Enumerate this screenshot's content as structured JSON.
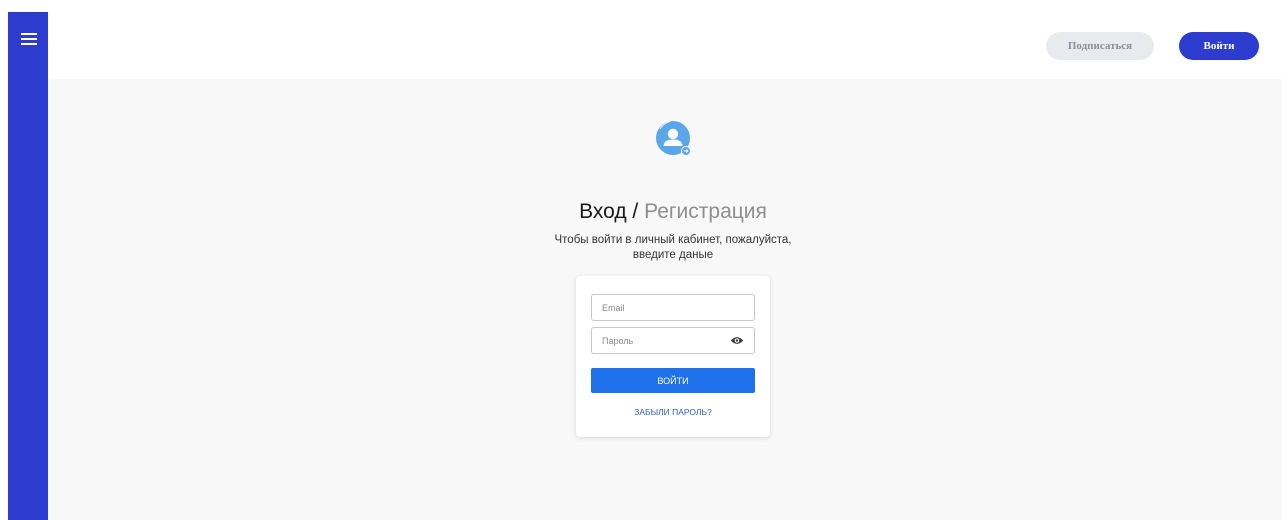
{
  "header": {
    "subscribe_label": "Подписаться",
    "login_label": "Войти"
  },
  "login": {
    "title_primary": "Вход /",
    "title_secondary": "Регистрация",
    "subtitle_line1": "Чтобы войти в личный кабинет, пожалуйста,",
    "subtitle_line2": "введите даные",
    "email_placeholder": "Email",
    "password_placeholder": "Пароль",
    "submit_label": "ВОЙТИ",
    "forgot_label": "ЗАБЫЛИ ПАРОЛЬ?"
  },
  "icons": {
    "menu": "hamburger-menu-icon",
    "avatar": "user-login-icon",
    "password_toggle": "eye-icon"
  },
  "colors": {
    "brand_blue": "#2c3ccf",
    "submit_blue": "#1e70eb",
    "link_blue": "#2d5fc6",
    "avatar_blue": "#5aa6e8",
    "page_background": "#f8f8f9"
  }
}
